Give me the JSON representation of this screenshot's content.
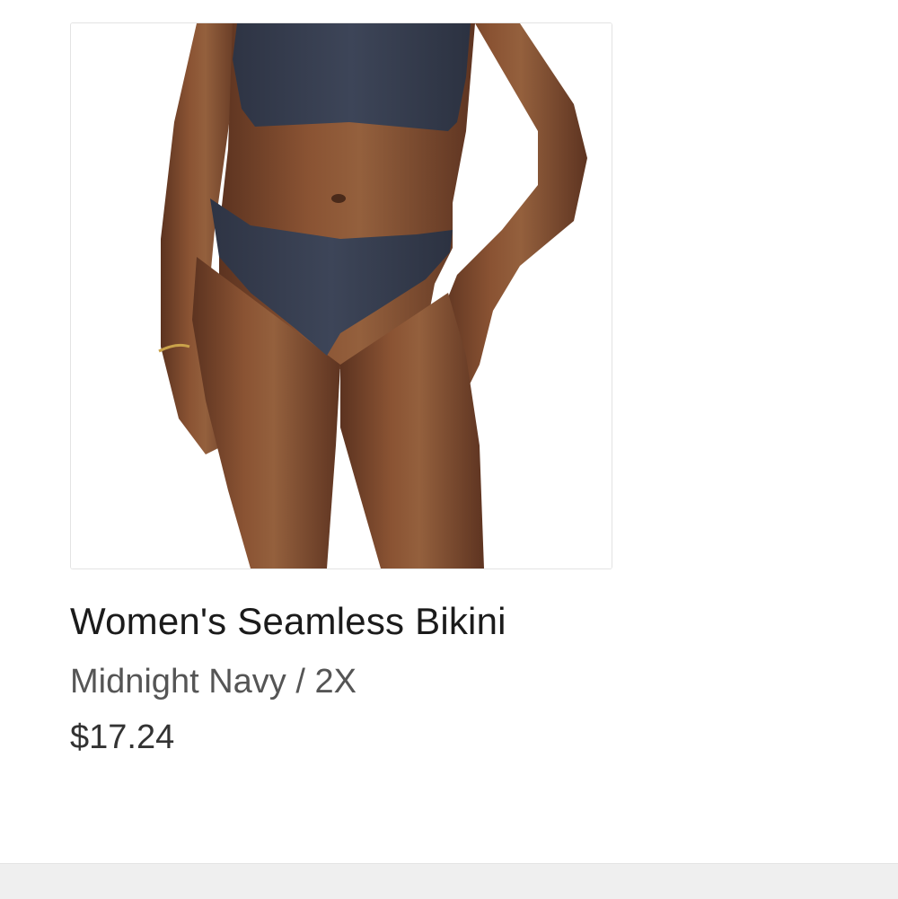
{
  "product": {
    "image_alt": "Model wearing navy seamless bra and bikini",
    "title": "Women's Seamless Bikini",
    "variant": "Midnight Navy / 2X",
    "price": "$17.24"
  },
  "colors": {
    "navy": "#353c4c",
    "skin": "#7a4a2e",
    "border": "#e3e3e3"
  }
}
